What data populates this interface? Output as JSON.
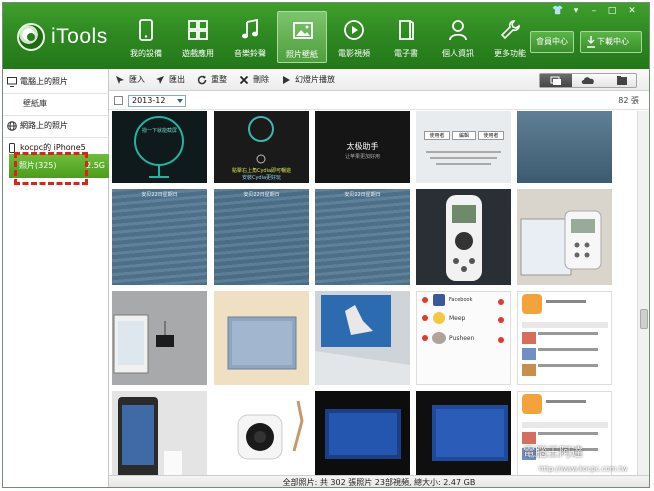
{
  "app": {
    "title": "iTools"
  },
  "nav": [
    {
      "label": "我的設備",
      "icon": "phone-icon"
    },
    {
      "label": "遊戲應用",
      "icon": "apps-grid-icon"
    },
    {
      "label": "音樂鈴聲",
      "icon": "music-note-icon"
    },
    {
      "label": "照片壁紙",
      "icon": "picture-icon"
    },
    {
      "label": "電影視頻",
      "icon": "play-icon"
    },
    {
      "label": "電子書",
      "icon": "book-icon"
    },
    {
      "label": "個人資訊",
      "icon": "person-icon"
    },
    {
      "label": "更多功能",
      "icon": "wrench-icon"
    }
  ],
  "nav_active": "照片壁紙",
  "header": {
    "member_label": "會員中心",
    "download_label": "下載中心"
  },
  "window_controls": {
    "minimize": "–",
    "restore": "□",
    "close": "✕"
  },
  "sidebar": {
    "pc_photos": "電腦上的照片",
    "wallpaper": "壁紙庫",
    "web_photos": "網路上的照片",
    "device": "kocpc的 iPhone5",
    "photos": "照片(325)",
    "photos_size": "2.5G"
  },
  "toolbar": {
    "import": "匯入",
    "export": "匯出",
    "refresh": "重整",
    "delete": "刪除",
    "slideshow": "幻燈片播放"
  },
  "filter": {
    "month": "2013-12",
    "count": "82 張"
  },
  "thumb_text": {
    "t1_caption": "撥一下就能截屏",
    "t2_caption_a": "點擊右上角Cydia即可暢遊",
    "t2_caption_b": "安裝Cydia更好玩",
    "t3_title": "太极助手",
    "t3_sub": "让苹果更加好用",
    "t4_btn_a": "使用者",
    "t4_btn_b": "編輯",
    "t4_btn_c": "使用者",
    "water_date": "安贝22日星期日",
    "fb_name": "Facebook",
    "meep_name": "Meep",
    "pusheen_name": "Pusheen"
  },
  "status": {
    "summary": "全部照片: 共 302 張照片 23部視頻, 總大小: 2.47 GB"
  },
  "watermark": {
    "text": "電腦王阿達",
    "url": "http://www.kocpc.com.tw"
  }
}
